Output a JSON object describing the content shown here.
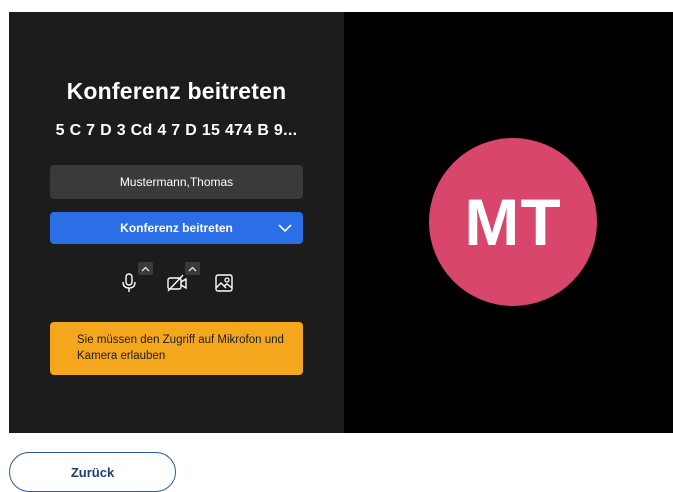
{
  "join_panel": {
    "title": "Konferenz beitreten",
    "meeting_id": "5 C 7 D 3 Cd 4 7 D 15 474 B 9...",
    "name_value": "Mustermann,Thomas",
    "join_button_label": "Konferenz beitreten",
    "warning_text": "Sie müssen den Zugriff auf Mikrofon und Kamera erlauben",
    "media_controls": [
      {
        "icon": "microphone-icon"
      },
      {
        "icon": "camera-off-icon"
      },
      {
        "icon": "background-image-icon"
      }
    ]
  },
  "preview": {
    "avatar_initials": "MT"
  },
  "footer": {
    "back_button_label": "Zurück"
  },
  "colors": {
    "panel_bg": "#1c1c1c",
    "preview_bg": "#000000",
    "primary_button": "#2b6ee6",
    "warning_bg": "#f4a61d",
    "avatar_bg": "#d9466b",
    "back_button_border": "#2c5aa0"
  }
}
